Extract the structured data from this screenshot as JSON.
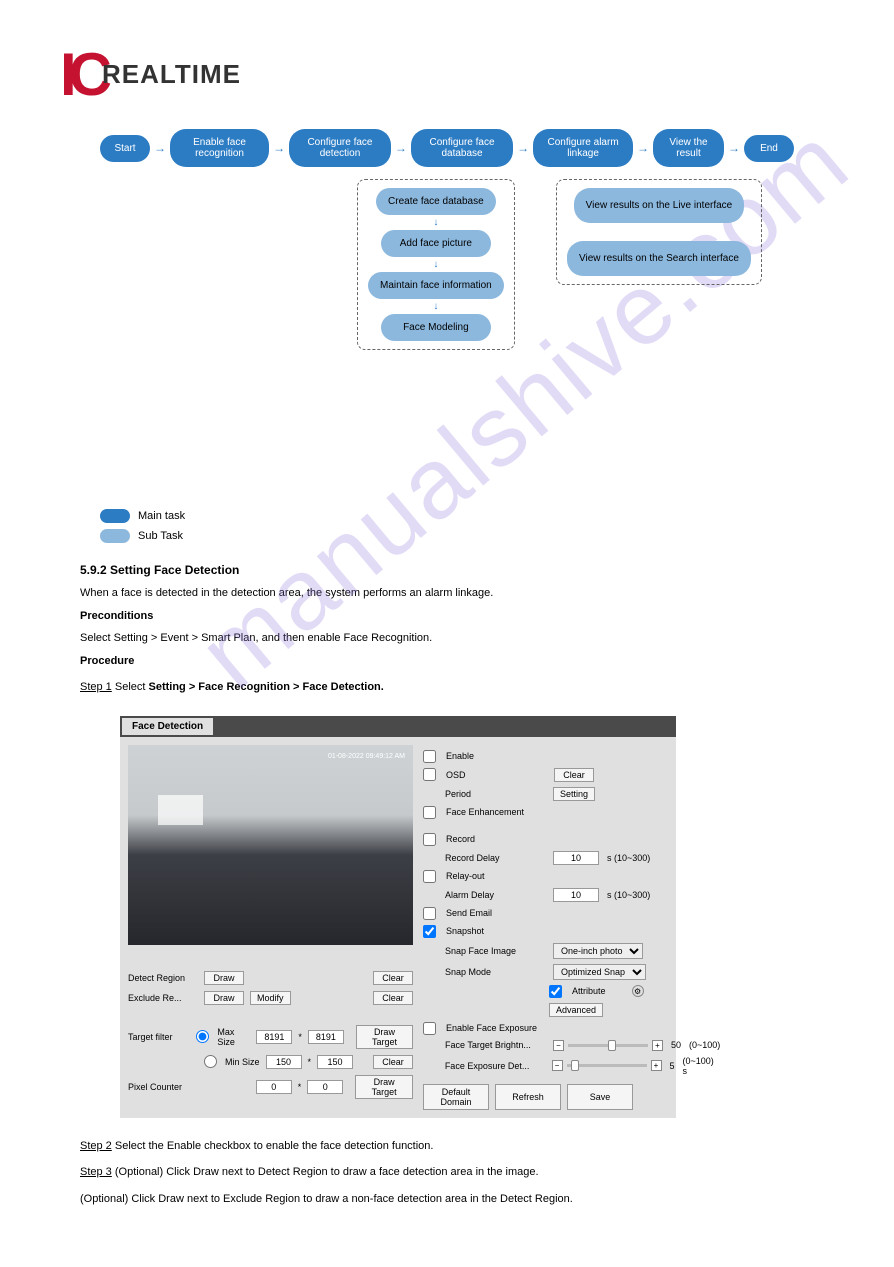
{
  "logo": {
    "ic": "IC",
    "realtime": "REALTIME"
  },
  "flowchart": {
    "main_nodes": [
      "Start",
      "Enable face recognition",
      "Configure face detection",
      "Configure face database",
      "Configure alarm linkage",
      "View the result",
      "End"
    ],
    "sub_group_a": [
      "Create face database",
      "Add face picture",
      "Maintain face information",
      "Face Modeling"
    ],
    "sub_group_b": [
      "View results on the Live interface",
      "View results on the Search interface"
    ]
  },
  "legend": {
    "main": "Main task",
    "sub": "Sub Task"
  },
  "section": {
    "title": "5.9.2 Setting Face Detection",
    "p1": "When a face is detected in the detection area, the system performs an alarm linkage.",
    "preconditions_label": "Preconditions",
    "preconditions_text": "Select Setting > Event > Smart Plan, and then enable Face Recognition.",
    "procedure_label": "Procedure",
    "step1_label": "Step 1",
    "step1_text": " Select ",
    "step1_path": "Setting > Face Recognition > Face Detection.",
    "step2_label": "Step 2",
    "step2_text": " Select the Enable checkbox to enable the face detection function.",
    "step3_label": "Step 3",
    "step3_text": " (Optional) Click Draw next to Detect Region to draw a face detection area in the image.",
    "post_text": "(Optional) Click Draw next to Exclude Region to draw a non-face detection area in the Detect Region."
  },
  "fd": {
    "title": "Face Detection",
    "timestamp": "01-08-2022 09:49:12 AM",
    "left": {
      "detect_region": "Detect Region",
      "exclude_region": "Exclude Re...",
      "draw": "Draw",
      "modify": "Modify",
      "clear": "Clear",
      "target_filter": "Target filter",
      "max_size": "Max Size",
      "min_size": "Min Size",
      "max_w": "8191",
      "max_h": "8191",
      "min_w": "150",
      "min_h": "150",
      "pixel_counter": "Pixel Counter",
      "pc_w": "0",
      "pc_h": "0",
      "draw_target": "Draw Target"
    },
    "right": {
      "enable": "Enable",
      "osd": "OSD",
      "clear": "Clear",
      "period": "Period",
      "setting": "Setting",
      "face_enhancement": "Face Enhancement",
      "record": "Record",
      "record_delay": "Record Delay",
      "record_delay_val": "10",
      "record_delay_unit": "s (10~300)",
      "relay_out": "Relay-out",
      "alarm_delay": "Alarm Delay",
      "alarm_delay_val": "10",
      "alarm_delay_unit": "s (10~300)",
      "send_email": "Send Email",
      "snapshot": "Snapshot",
      "snap_face_image": "Snap Face Image",
      "snap_face_image_val": "One-inch photo",
      "snap_mode": "Snap Mode",
      "snap_mode_val": "Optimized Snap",
      "attribute": "Attribute",
      "advanced": "Advanced",
      "enable_face_exposure": "Enable Face Exposure",
      "face_target_brightness": "Face Target Brightn...",
      "ftb_val": "50",
      "ftb_range": "(0~100)",
      "face_exposure_det": "Face Exposure Det...",
      "fed_val": "5",
      "fed_range": "(0~100) s",
      "default_domain": "Default Domain",
      "refresh": "Refresh",
      "save": "Save"
    }
  },
  "watermark": "manualshive.com"
}
